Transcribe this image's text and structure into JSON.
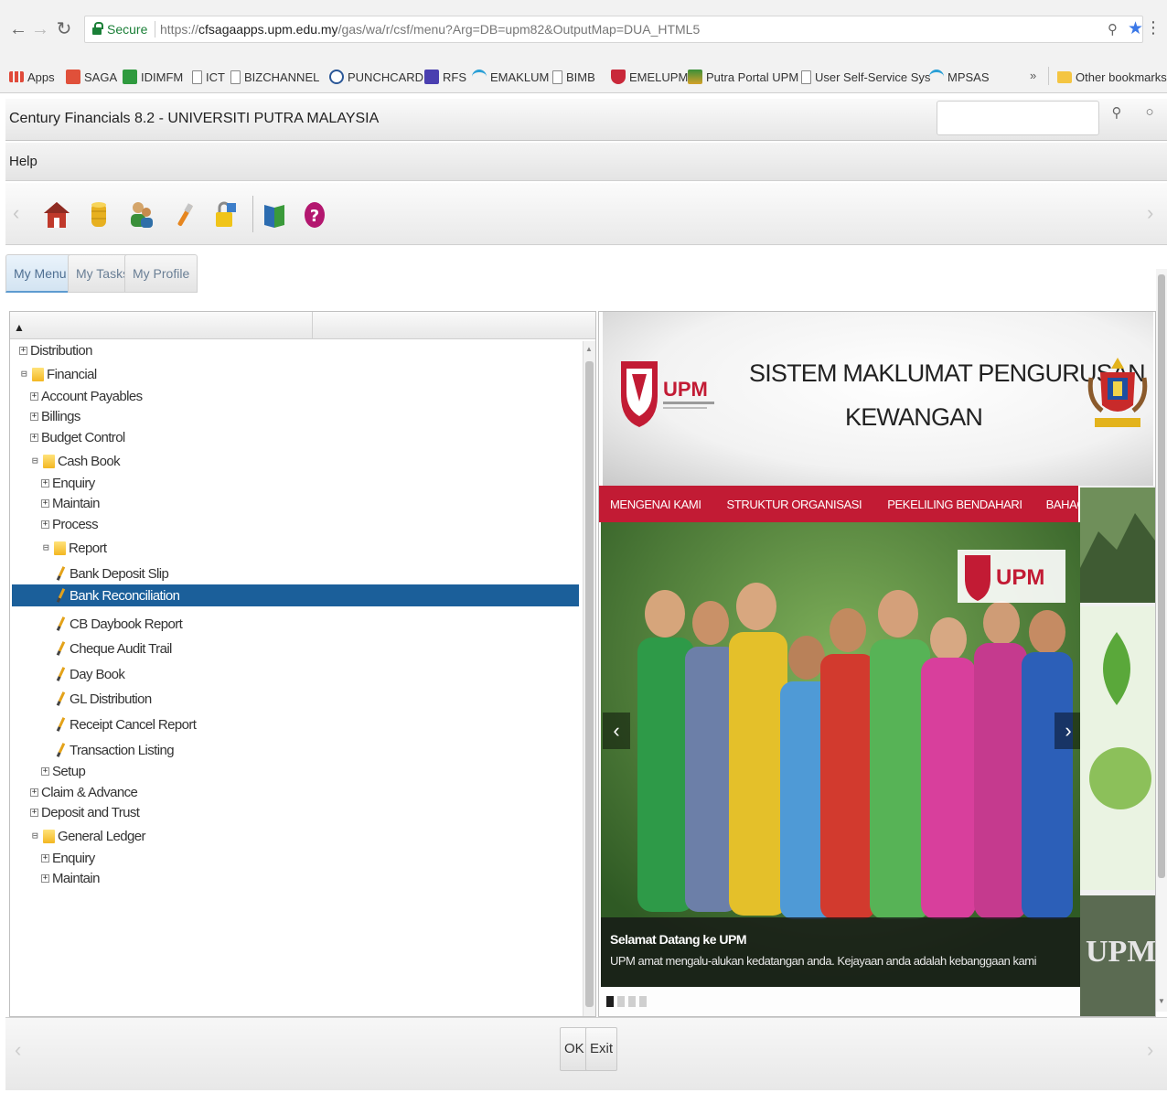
{
  "browser": {
    "secure_label": "Secure",
    "url_prefix": "https://",
    "url_host": "cfsagaapps.upm.edu.my",
    "url_path": "/gas/wa/r/csf/menu?Arg=DB=upm82&OutputMap=DUA_HTML5",
    "bookmarks": [
      {
        "label": "Apps"
      },
      {
        "label": "SAGA"
      },
      {
        "label": "IDIMFM"
      },
      {
        "label": "ICT"
      },
      {
        "label": "BIZCHANNEL"
      },
      {
        "label": "PUNCHCARD"
      },
      {
        "label": "RFS"
      },
      {
        "label": "EMAKLUM"
      },
      {
        "label": "BIMB"
      },
      {
        "label": "EMELUPM"
      },
      {
        "label": "Putra Portal UPM"
      },
      {
        "label": "User Self-Service Sys"
      },
      {
        "label": "MPSAS"
      }
    ],
    "overflow_label": "»",
    "other_bookmarks": "Other bookmarks"
  },
  "app": {
    "title": "Century Financials 8.2 - UNIVERSITI PUTRA MALAYSIA",
    "menu_help": "Help",
    "tabs": [
      {
        "label": "My Menu"
      },
      {
        "label": "My Tasks"
      },
      {
        "label": "My Profile"
      }
    ]
  },
  "tree": {
    "nodes": [
      {
        "label": "Distribution"
      },
      {
        "label": "Financial"
      },
      {
        "label": "Account Payables"
      },
      {
        "label": "Billings"
      },
      {
        "label": "Budget Control"
      },
      {
        "label": "Cash Book"
      },
      {
        "label": "Enquiry"
      },
      {
        "label": "Maintain"
      },
      {
        "label": "Process"
      },
      {
        "label": "Report"
      },
      {
        "label": "Bank Deposit Slip"
      },
      {
        "label": "Bank Reconciliation"
      },
      {
        "label": "CB Daybook Report"
      },
      {
        "label": "Cheque Audit Trail"
      },
      {
        "label": "Day Book"
      },
      {
        "label": "GL Distribution"
      },
      {
        "label": "Receipt Cancel Report"
      },
      {
        "label": "Transaction Listing"
      },
      {
        "label": "Setup"
      },
      {
        "label": "Claim & Advance"
      },
      {
        "label": "Deposit and Trust"
      },
      {
        "label": "General Ledger"
      },
      {
        "label": "Enquiry"
      },
      {
        "label": "Maintain"
      }
    ],
    "selected": "Bank Reconciliation"
  },
  "portal": {
    "logo_text": "UPM",
    "title_line1": "SISTEM MAKLUMAT PENGURUSAN",
    "title_line2": "KEWANGAN",
    "nav": [
      "MENGENAI KAMI",
      "STRUKTUR ORGANISASI",
      "PEKELILING BENDAHARI",
      "BAHAGIAN"
    ],
    "caption_title": "Selamat Datang ke UPM",
    "caption_sub": "UPM amat mengalu-alukan kedatangan anda. Kejayaan anda adalah kebanggaan kami",
    "slide_dots_active": 1,
    "slide_dots_total": 4
  },
  "footer": {
    "ok_label": "OK",
    "exit_label": "Exit"
  },
  "colors": {
    "selection": "#1b5f9a",
    "brand_red": "#c21b34",
    "secure_green": "#1a7f37"
  }
}
